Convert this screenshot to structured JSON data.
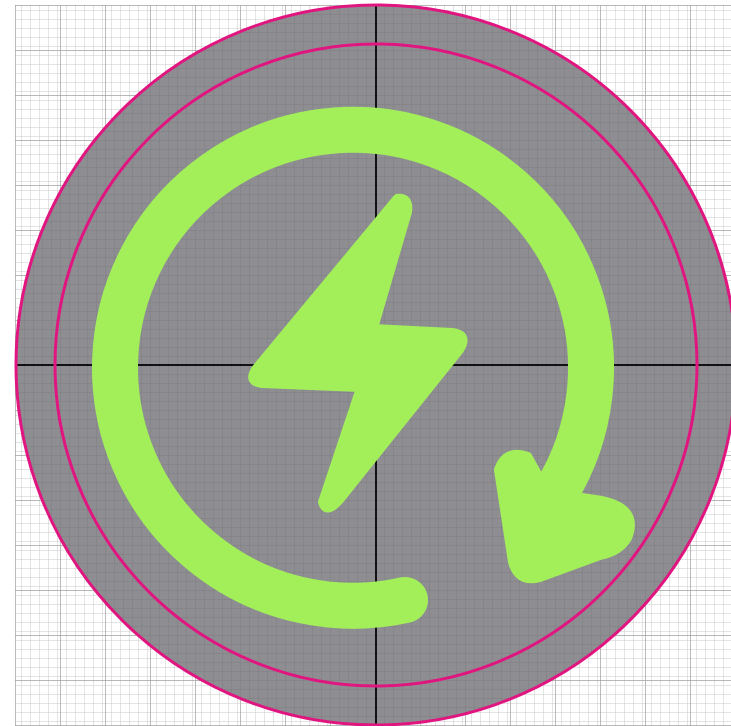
{
  "icon": {
    "semantic_name": "energy-refresh-icon",
    "glyph_name": "lightning-bolt-icon",
    "arrow_name": "circular-arrow-icon"
  },
  "colors": {
    "page_background": "#ffffff",
    "grid_minor": "#c9c9c9",
    "grid_major": "#a0a0a0",
    "disc_fill": "#8e8e92",
    "ring_stroke": "#e0157f",
    "axis_stroke": "#111111",
    "glyph_fill": "#a3ef5a"
  }
}
